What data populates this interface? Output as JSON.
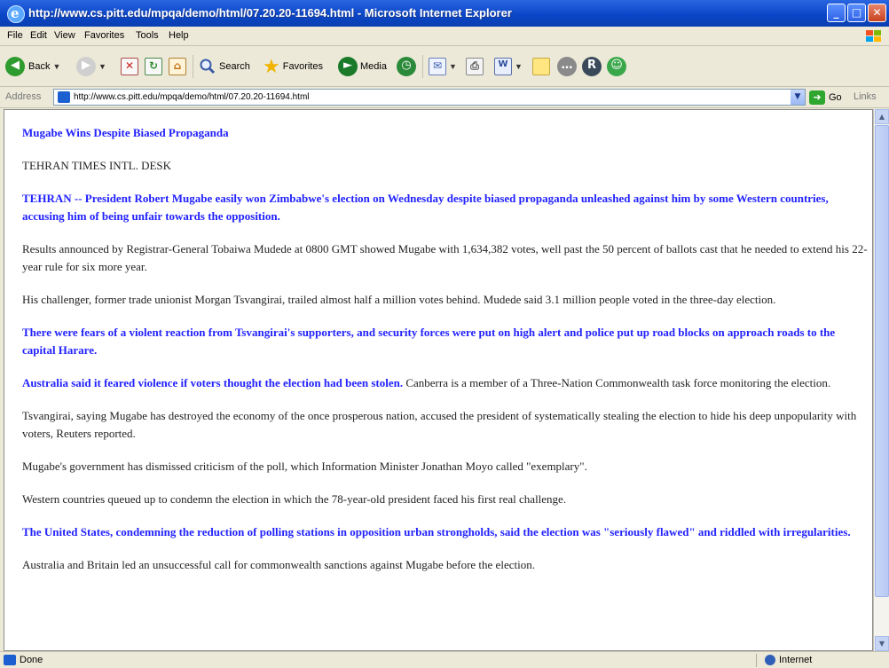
{
  "window": {
    "title": "http://www.cs.pitt.edu/mpqa/demo/html/07.20.20-11694.html - Microsoft Internet Explorer"
  },
  "menu": [
    "File",
    "Edit",
    "View",
    "Favorites",
    "Tools",
    "Help"
  ],
  "toolbar": {
    "back_label": "Back",
    "search_label": "Search",
    "favorites_label": "Favorites",
    "media_label": "Media"
  },
  "address": {
    "label": "Address",
    "url": "http://www.cs.pitt.edu/mpqa/demo/html/07.20.20-11694.html",
    "go_label": "Go",
    "links_label": "Links"
  },
  "article": {
    "headline": "Mugabe Wins Despite Biased Propaganda",
    "desk": "TEHRAN TIMES INTL. DESK",
    "p1": "TEHRAN -- President Robert Mugabe easily won Zimbabwe's election on Wednesday despite biased propaganda unleashed against him by some Western countries, accusing him of being unfair towards the opposition.",
    "p2": "Results announced by Registrar-General Tobaiwa Mudede at 0800 GMT showed Mugabe with 1,634,382 votes, well past the 50 percent of ballots cast that he needed to extend his 22-year rule for six more year.",
    "p3": "His challenger, former trade unionist Morgan Tsvangirai, trailed almost half a million votes behind. Mudede said 3.1 million people voted in the three-day election.",
    "p4": "There were fears of a violent reaction from Tsvangirai's supporters, and security forces were put on high alert and police put up road blocks on approach roads to the capital Harare.",
    "p5_highlight": "Australia said it feared violence if voters thought the election had been stolen.",
    "p5_rest": " Canberra is a member of a Three-Nation Commonwealth task force monitoring the election.",
    "p6": "Tsvangirai, saying Mugabe has destroyed the economy of the once prosperous nation, accused the president of systematically stealing the election to hide his deep unpopularity with voters, Reuters reported.",
    "p7": "Mugabe's government has dismissed criticism of the poll, which Information Minister Jonathan Moyo called \"exemplary\".",
    "p8": "Western countries queued up to condemn the election in which the 78-year-old president faced his first real challenge.",
    "p9": "The United States, condemning the reduction of polling stations in opposition urban strongholds, said the election was \"seriously flawed\" and riddled with irregularities.",
    "p10": "Australia and Britain led an unsuccessful call for commonwealth sanctions against Mugabe before the election."
  },
  "status": {
    "text": "Done",
    "zone": "Internet"
  },
  "colors": {
    "highlight": "#2222ff",
    "titlebar": "#0a46c8"
  }
}
